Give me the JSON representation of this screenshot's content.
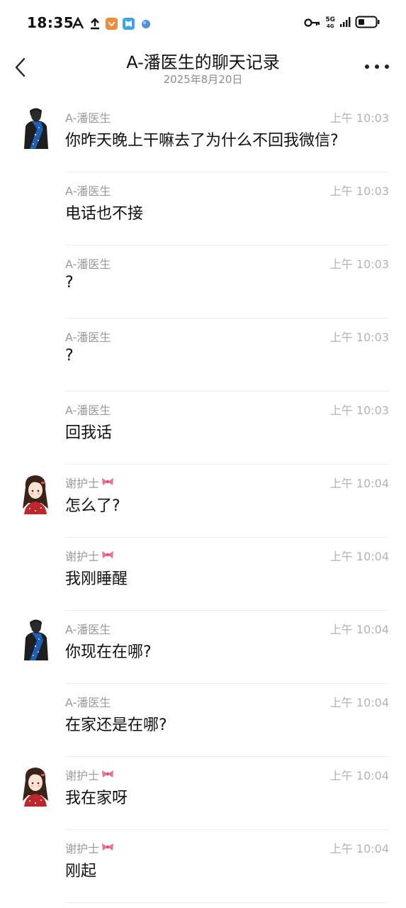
{
  "status_bar": {
    "time": "18:35",
    "network": "5G",
    "network_sub": "4G",
    "icons": [
      "a-app-icon",
      "upload-icon",
      "shopping-icon",
      "book-icon",
      "blue-app-icon",
      "key-icon",
      "signal-icon",
      "battery-icon"
    ]
  },
  "header": {
    "title": "A-潘医生的聊天记录",
    "subtitle": "2025年8月20日"
  },
  "messages": [
    {
      "sender": "A-潘医生",
      "bow": false,
      "time": "上午 10:03",
      "text": "你昨天晚上干嘛去了为什么不回我微信?",
      "avatar": "male"
    },
    {
      "sender": "A-潘医生",
      "bow": false,
      "time": "上午 10:03",
      "text": "电话也不接",
      "avatar": ""
    },
    {
      "sender": "A-潘医生",
      "bow": false,
      "time": "上午 10:03",
      "text": "?",
      "avatar": ""
    },
    {
      "sender": "A-潘医生",
      "bow": false,
      "time": "上午 10:03",
      "text": "?",
      "avatar": ""
    },
    {
      "sender": "A-潘医生",
      "bow": false,
      "time": "上午 10:03",
      "text": "回我话",
      "avatar": ""
    },
    {
      "sender": "谢护士",
      "bow": true,
      "time": "上午 10:04",
      "text": "怎么了?",
      "avatar": "female"
    },
    {
      "sender": "谢护士",
      "bow": true,
      "time": "上午 10:04",
      "text": "我刚睡醒",
      "avatar": ""
    },
    {
      "sender": "A-潘医生",
      "bow": false,
      "time": "上午 10:04",
      "text": "你现在在哪?",
      "avatar": "male"
    },
    {
      "sender": "A-潘医生",
      "bow": false,
      "time": "上午 10:04",
      "text": "在家还是在哪?",
      "avatar": ""
    },
    {
      "sender": "谢护士",
      "bow": true,
      "time": "上午 10:04",
      "text": "我在家呀",
      "avatar": "female"
    },
    {
      "sender": "谢护士",
      "bow": true,
      "time": "上午 10:04",
      "text": "刚起",
      "avatar": ""
    }
  ],
  "colors": {
    "sender": "#9a9a9a",
    "time": "#b3b3b3",
    "bow": "#f26d8f",
    "male_scarf": "#1e5fb8",
    "female_top": "#c0272d"
  }
}
